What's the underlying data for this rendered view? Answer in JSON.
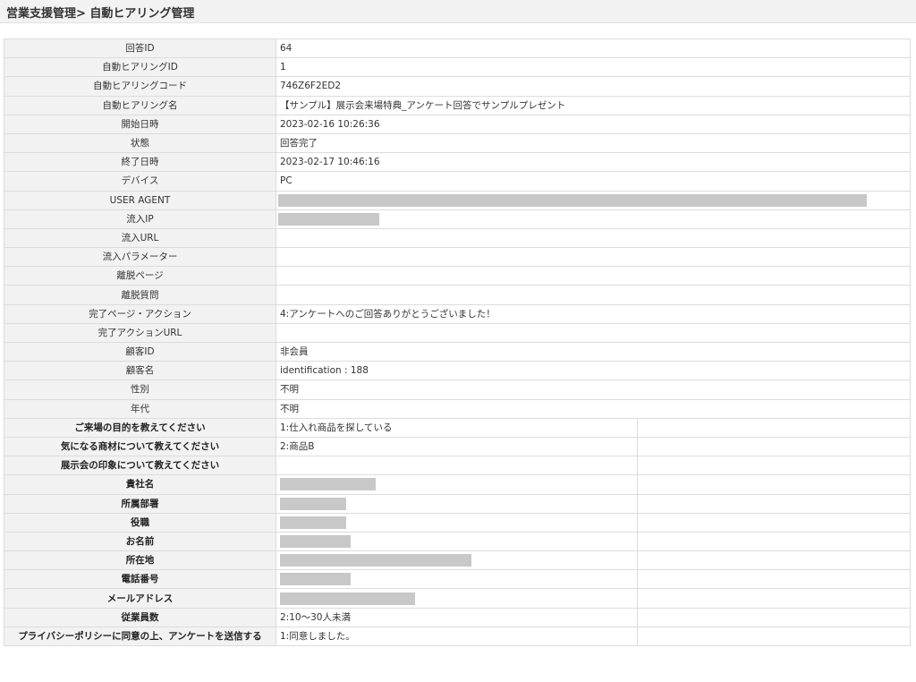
{
  "header": {
    "title": "営業支援管理> 自動ヒアリング管理"
  },
  "detail_rows": [
    {
      "label": "回答ID",
      "value": "64"
    },
    {
      "label": "自動ヒアリングID",
      "value": "1"
    },
    {
      "label": "自動ヒアリングコード",
      "value": "746Z6F2ED2"
    },
    {
      "label": "自動ヒアリング名",
      "value": "【サンプル】展示会来場特典_アンケート回答でサンプルプレゼント"
    },
    {
      "label": "開始日時",
      "value": "2023-02-16 10:26:36"
    },
    {
      "label": "状態",
      "value": "回答完了"
    },
    {
      "label": "終了日時",
      "value": "2023-02-17 10:46:16"
    },
    {
      "label": "デバイス",
      "value": "PC"
    },
    {
      "label": "USER AGENT",
      "value": ""
    },
    {
      "label": "流入IP",
      "value": ""
    },
    {
      "label": "流入URL",
      "value": ""
    },
    {
      "label": "流入パラメーター",
      "value": ""
    },
    {
      "label": "離脱ページ",
      "value": ""
    },
    {
      "label": "離脱質問",
      "value": ""
    },
    {
      "label": "完了ページ・アクション",
      "value": "4:アンケートへのご回答ありがとうございました！"
    },
    {
      "label": "完了アクションURL",
      "value": ""
    },
    {
      "label": "顧客ID",
      "value": "非会員"
    },
    {
      "label": "顧客名",
      "value": "identification : 188"
    },
    {
      "label": "性別",
      "value": "不明"
    },
    {
      "label": "年代",
      "value": "不明"
    }
  ],
  "question_rows": [
    {
      "label": "ご来場の目的を教えてください",
      "value": "1:仕入れ商品を探している"
    },
    {
      "label": "気になる商材について教えてください",
      "value": "2:商品B"
    },
    {
      "label": "展示会の印象について教えてください",
      "value": ""
    },
    {
      "label": "貴社名",
      "value": ""
    },
    {
      "label": "所属部署",
      "value": ""
    },
    {
      "label": "役職",
      "value": ""
    },
    {
      "label": "お名前",
      "value": ""
    },
    {
      "label": "所在地",
      "value": ""
    },
    {
      "label": "電話番号",
      "value": ""
    },
    {
      "label": "メールアドレス",
      "value": ""
    },
    {
      "label": "従業員数",
      "value": "2:10〜30人未満"
    },
    {
      "label": "プライバシーポリシーに同意の上、アンケートを送信する",
      "value": "1:同意しました。"
    }
  ],
  "colors": {
    "label_background": "#f2f2f2",
    "border": "#dcdcdc",
    "redaction": "#c8c8c8",
    "text": "#333333"
  }
}
